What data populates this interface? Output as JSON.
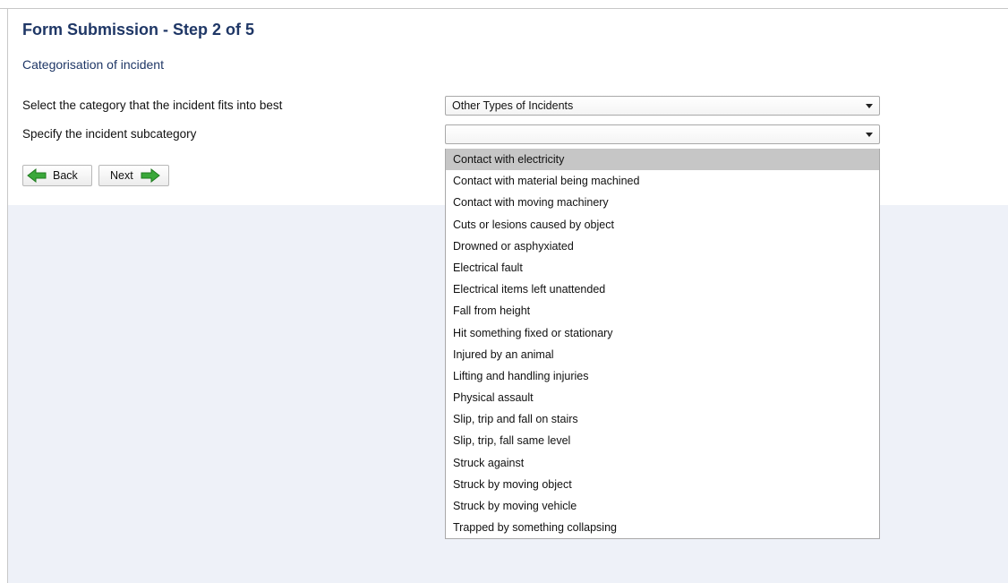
{
  "form": {
    "title": "Form Submission - Step 2 of 5",
    "section": "Categorisation of incident"
  },
  "category": {
    "label": "Select the category that the incident fits into best",
    "value": "Other Types of Incidents"
  },
  "subcategory": {
    "label": "Specify the incident subcategory",
    "value": "",
    "highlighted_index": 0,
    "options": [
      "Contact with electricity",
      "Contact with material being machined",
      "Contact with moving machinery",
      "Cuts or lesions caused by object",
      "Drowned or asphyxiated",
      "Electrical fault",
      "Electrical items left unattended",
      "Fall from height",
      "Hit something fixed or stationary",
      "Injured by an animal",
      "Lifting and handling injuries",
      "Physical assault",
      "Slip, trip and fall on stairs",
      "Slip, trip, fall same level",
      "Struck against",
      "Struck by moving object",
      "Struck by moving vehicle",
      "Trapped by something collapsing"
    ]
  },
  "buttons": {
    "back_label": "Back",
    "next_label": "Next"
  },
  "icons": {
    "back": "arrow-left-icon",
    "next": "arrow-right-icon"
  },
  "colors": {
    "title": "#1f3766",
    "arrow": "#3aa83a",
    "highlight": "#c6c6c6",
    "lower_background": "#eef1f8"
  }
}
